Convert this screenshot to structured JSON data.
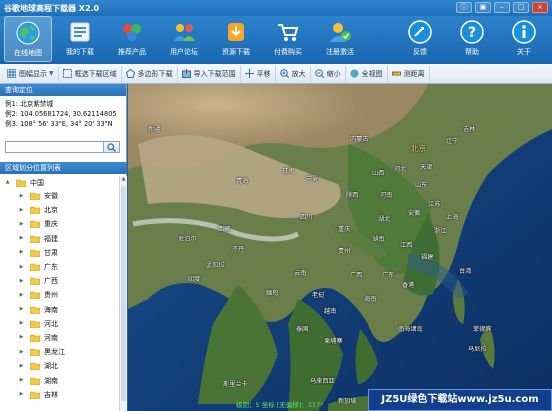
{
  "window": {
    "title": "谷歌地球高程下载器 X2.0",
    "controls": [
      {
        "name": "info-icon",
        "glyph": "ⓘ"
      },
      {
        "name": "skin-icon",
        "glyph": "▣"
      },
      {
        "name": "minimize-icon",
        "glyph": "–"
      },
      {
        "name": "maximize-icon",
        "glyph": "□"
      },
      {
        "name": "close-icon",
        "glyph": "×"
      }
    ]
  },
  "main_toolbar": {
    "items": [
      {
        "label": "在线地图",
        "icon": "globe-icon",
        "active": true
      },
      {
        "label": "我的下载",
        "icon": "download-list-icon"
      },
      {
        "label": "推荐产品",
        "icon": "products-icon"
      },
      {
        "label": "用户论坛",
        "icon": "forum-icon"
      },
      {
        "label": "资源下载",
        "icon": "resource-download-icon"
      },
      {
        "label": "付费购买",
        "icon": "cart-icon"
      },
      {
        "label": "注册激活",
        "icon": "register-icon"
      }
    ],
    "right_items": [
      {
        "label": "反馈",
        "icon": "feedback-icon"
      },
      {
        "label": "帮助",
        "icon": "help-icon"
      },
      {
        "label": "关于",
        "icon": "about-icon"
      }
    ]
  },
  "sub_toolbar": {
    "items": [
      {
        "label": "图幅显示",
        "icon": "grid-icon",
        "dropdown": true
      },
      {
        "label": "框选下载区域",
        "icon": "rect-select-icon"
      },
      {
        "label": "多边形下载",
        "icon": "polygon-icon"
      },
      {
        "label": "导入下载范围",
        "icon": "import-icon"
      },
      {
        "label": "平移",
        "icon": "pan-icon"
      },
      {
        "label": "放大",
        "icon": "zoom-in-icon"
      },
      {
        "label": "缩小",
        "icon": "zoom-out-icon"
      },
      {
        "label": "全视图",
        "icon": "full-view-icon"
      },
      {
        "label": "测距离",
        "icon": "measure-icon"
      }
    ]
  },
  "left_panel": {
    "locate_header": "查询定位",
    "locate_examples": [
      "例1: 北京紫禁城",
      "例2: 104.05681724, 30.62114805",
      "例3: 108° 56' 33\"E, 34° 20' 33\"N"
    ],
    "search_value": "",
    "region_header": "区域划分位置列表",
    "tree_root": "中国",
    "tree_items": [
      "安徽",
      "北京",
      "重庆",
      "福建",
      "甘肃",
      "广东",
      "广西",
      "贵州",
      "海南",
      "河北",
      "河南",
      "黑龙江",
      "湖北",
      "湖南",
      "吉林"
    ]
  },
  "map": {
    "labels": [
      {
        "text": "北京",
        "class": "big yellow"
      },
      {
        "text": "河北"
      },
      {
        "text": "天津"
      },
      {
        "text": "山西"
      },
      {
        "text": "山东"
      },
      {
        "text": "内蒙古"
      },
      {
        "text": "辽宁"
      },
      {
        "text": "吉林"
      },
      {
        "text": "河南"
      },
      {
        "text": "陕西"
      },
      {
        "text": "江苏"
      },
      {
        "text": "安徽"
      },
      {
        "text": "上海"
      },
      {
        "text": "湖北"
      },
      {
        "text": "浙江"
      },
      {
        "text": "湖南"
      },
      {
        "text": "江西"
      },
      {
        "text": "福建"
      },
      {
        "text": "四川"
      },
      {
        "text": "重庆"
      },
      {
        "text": "贵州"
      },
      {
        "text": "云南"
      },
      {
        "text": "广西"
      },
      {
        "text": "广东"
      },
      {
        "text": "台湾"
      },
      {
        "text": "香港"
      },
      {
        "text": "海南"
      },
      {
        "text": "甘肃"
      },
      {
        "text": "青海"
      },
      {
        "text": "宁夏"
      },
      {
        "text": "西藏"
      },
      {
        "text": "新疆"
      },
      {
        "text": "印度"
      },
      {
        "text": "缅甸"
      },
      {
        "text": "泰国"
      },
      {
        "text": "越南"
      },
      {
        "text": "老挝"
      },
      {
        "text": "柬埔寨"
      },
      {
        "text": "孟加拉"
      },
      {
        "text": "尼泊尔"
      },
      {
        "text": "不丹"
      },
      {
        "text": "马来西亚"
      },
      {
        "text": "菲律宾"
      },
      {
        "text": "斯里兰卡"
      },
      {
        "text": "南海诸岛"
      },
      {
        "text": "马尼拉"
      },
      {
        "text": "新加坡"
      }
    ]
  },
  "status": {
    "text": "级别：5   坐标 [无偏移]：117°"
  },
  "watermark": "JZ5U绿色下载站www.jz5u.com",
  "colors": {
    "titlebar": "#1f6fb8",
    "accent": "#2c83cc",
    "ocean": "#103c78",
    "status_text": "#5fe36b"
  }
}
